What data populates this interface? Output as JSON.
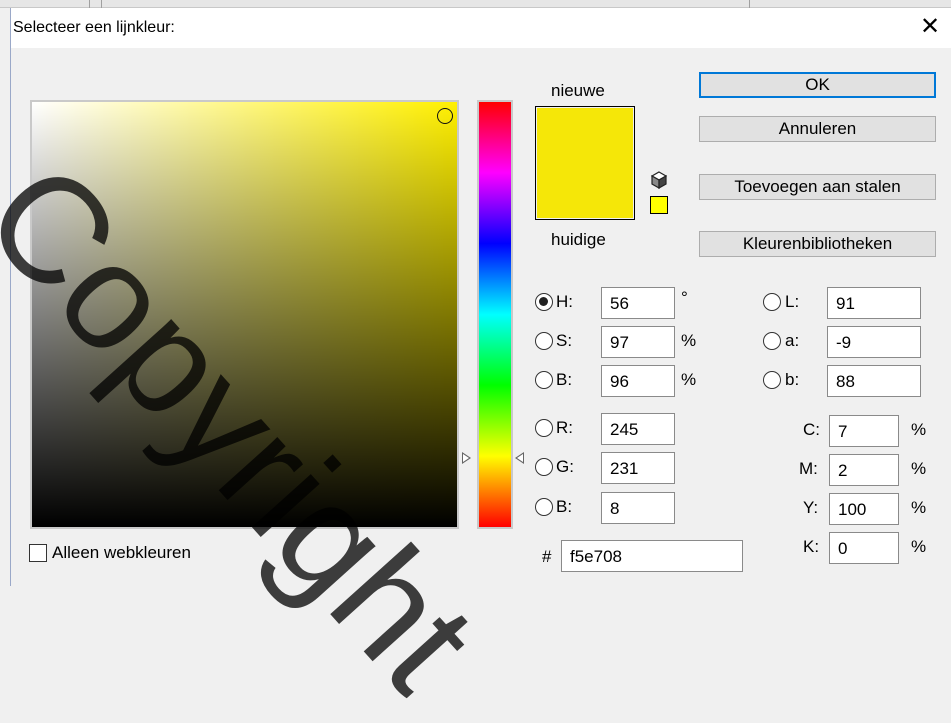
{
  "dialog": {
    "title": "Selecteer een lijnkleur:",
    "close_symbol": "✕"
  },
  "colors": {
    "new": "#f5e708",
    "current": "#f5e708",
    "field_hue": "#fff000",
    "button_focus": "#0078d7"
  },
  "swatches": {
    "new_label": "nieuwe",
    "current_label": "huidige",
    "cube_icon": "cube-icon",
    "websafe_swatch_color": "#ffff00"
  },
  "buttons": {
    "ok": "OK",
    "cancel": "Annuleren",
    "add_to_swatches": "Toevoegen aan stalen",
    "color_libraries": "Kleurenbibliotheken"
  },
  "hsb": {
    "h": {
      "label": "H:",
      "value": "56",
      "unit": "°",
      "selected": true
    },
    "s": {
      "label": "S:",
      "value": "97",
      "unit": "%",
      "selected": false
    },
    "b": {
      "label": "B:",
      "value": "96",
      "unit": "%",
      "selected": false
    }
  },
  "rgb": {
    "r": {
      "label": "R:",
      "value": "245"
    },
    "g": {
      "label": "G:",
      "value": "231"
    },
    "b": {
      "label": "B:",
      "value": "8"
    }
  },
  "lab": {
    "l": {
      "label": "L:",
      "value": "91"
    },
    "a": {
      "label": "a:",
      "value": "-9"
    },
    "b": {
      "label": "b:",
      "value": "88"
    }
  },
  "cmyk": {
    "c": {
      "label": "C:",
      "value": "7",
      "unit": "%"
    },
    "m": {
      "label": "M:",
      "value": "2",
      "unit": "%"
    },
    "y": {
      "label": "Y:",
      "value": "100",
      "unit": "%"
    },
    "k": {
      "label": "K:",
      "value": "0",
      "unit": "%"
    }
  },
  "hex": {
    "label": "#",
    "value": "f5e708"
  },
  "web_only": {
    "label": "Alleen webkleuren",
    "checked": false
  },
  "watermark": "Copyright"
}
